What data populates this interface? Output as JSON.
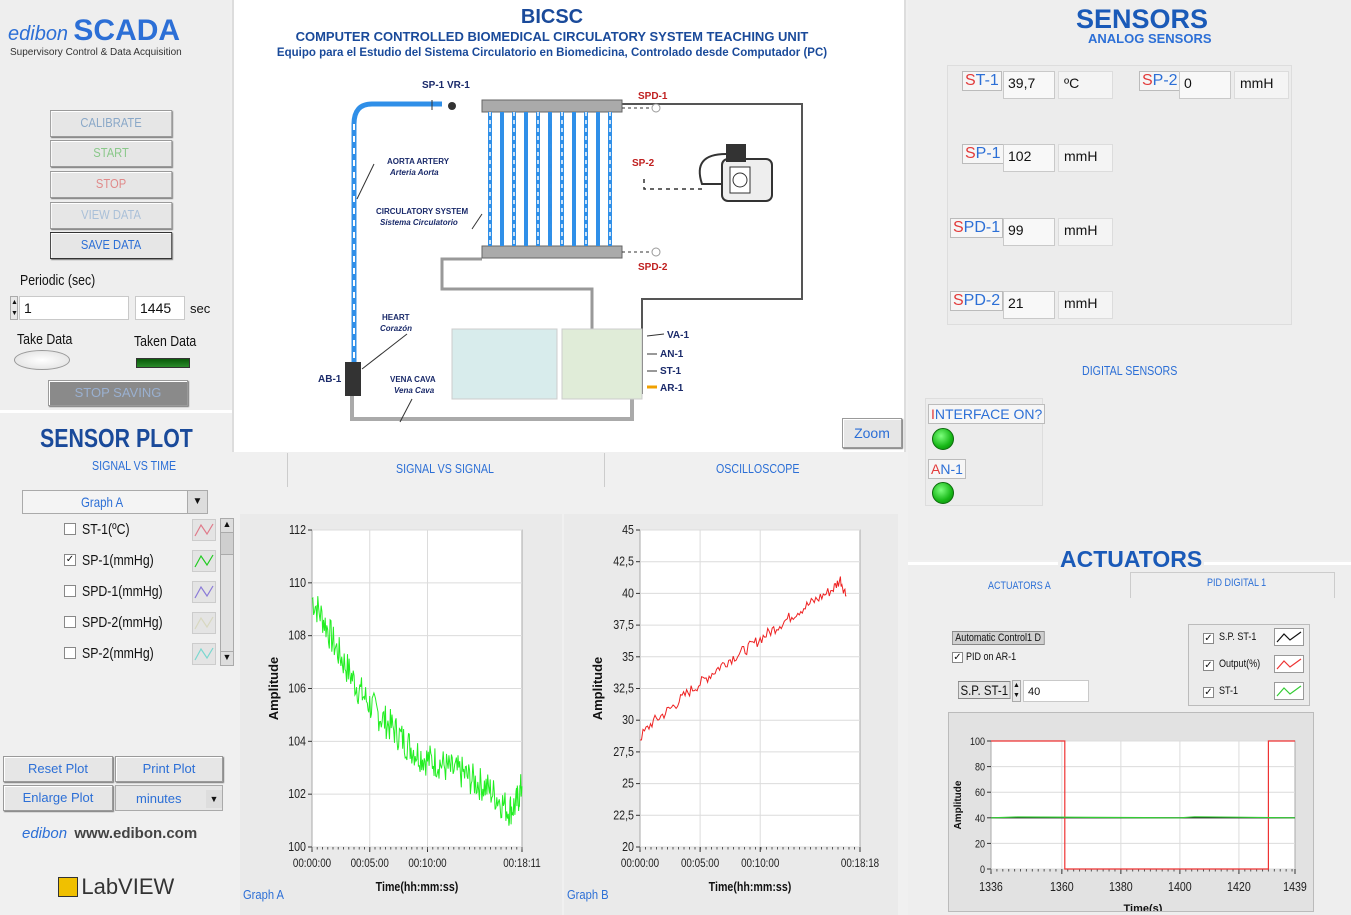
{
  "brand": {
    "logo_text": "edibon",
    "title": "SCADA",
    "subtitle": "Supervisory Control & Data Acquisition"
  },
  "controls": {
    "buttons": [
      "CALIBRATE",
      "START",
      "STOP",
      "VIEW DATA",
      "SAVE DATA"
    ],
    "periodic_label": "Periodic (sec)",
    "periodic_value": "1",
    "elapsed_value": "1445",
    "elapsed_unit": "sec",
    "take_data_label": "Take Data",
    "taken_data_label": "Taken Data",
    "stop_saving_label": "STOP SAVING"
  },
  "diagram": {
    "title": "BICSC",
    "subtitle": "COMPUTER CONTROLLED BIOMEDICAL CIRCULATORY SYSTEM TEACHING UNIT",
    "subtitle_es": "Equipo para el Estudio del Sistema Circulatorio en Biomedicina, Controlado desde Computador (PC)",
    "labels": {
      "sp1vr1": "SP-1 VR-1",
      "spd1": "SPD-1",
      "sp2": "SP-2",
      "spd2": "SPD-2",
      "aorta": "AORTA ARTERY",
      "aorta_es": "Arteria Aorta",
      "circ": "CIRCULATORY SYSTEM",
      "circ_es": "Sistema Circulatorio",
      "heart": "HEART",
      "heart_es": "Corazón",
      "vena": "VENA CAVA",
      "vena_es": "Vena Cava",
      "ab1": "AB-1",
      "va1": "VA-1",
      "an1": "AN-1",
      "st1": "ST-1",
      "ar1": "AR-1"
    },
    "zoom_label": "Zoom"
  },
  "sensors": {
    "title": "SENSORS",
    "analog_title": "ANALOG SENSORS",
    "digital_title": "DIGITAL SENSORS",
    "analog": [
      {
        "pre": "S",
        "post": "T-1",
        "value": "39,7",
        "unit": "ºC"
      },
      {
        "pre": "S",
        "post": "P-2",
        "value": "0",
        "unit": "mmH"
      },
      {
        "pre": "S",
        "post": "P-1",
        "value": "102",
        "unit": "mmH"
      },
      {
        "pre": "S",
        "post": "PD-1",
        "value": "99",
        "unit": "mmH"
      },
      {
        "pre": "S",
        "post": "PD-2",
        "value": "21",
        "unit": "mmH"
      }
    ],
    "digital": [
      {
        "label": "INTERFACE ON?",
        "pre": "I",
        "post": "NTERFACE ON?"
      },
      {
        "label": "AN-1",
        "pre": "A",
        "post": "N-1"
      }
    ]
  },
  "sensor_plot": {
    "title": "SENSOR PLOT",
    "tabs": [
      "SIGNAL VS TIME",
      "SIGNAL VS SIGNAL",
      "OSCILLOSCOPE"
    ],
    "graph_select": "Graph A",
    "channels": [
      {
        "label": "ST-1(ºC)",
        "checked": false,
        "color": "#e07a8a"
      },
      {
        "label": "SP-1(mmHg)",
        "checked": true,
        "color": "#22cc22"
      },
      {
        "label": "SPD-1(mmHg)",
        "checked": false,
        "color": "#8a7ad8"
      },
      {
        "label": "SPD-2(mmHg)",
        "checked": false,
        "color": "#d8d8c0"
      },
      {
        "label": "SP-2(mmHg)",
        "checked": false,
        "color": "#7ad8d0"
      }
    ],
    "reset_plot": "Reset Plot",
    "print_plot": "Print Plot",
    "enlarge_plot": "Enlarge Plot",
    "time_unit": "minutes"
  },
  "footer": {
    "url": "www.edibon.com",
    "labview": "LabVIEW"
  },
  "chart_data": [
    {
      "type": "line",
      "title": "Graph A",
      "xlabel": "Time(hh:mm:ss)",
      "ylabel": "Amplitude",
      "ylim": [
        100,
        112
      ],
      "yticks": [
        "112",
        "110",
        "108",
        "106",
        "104",
        "102",
        "100"
      ],
      "xticks": [
        "00:00:00",
        "00:05:00",
        "00:10:00",
        "00:18:11"
      ],
      "xlim_seconds": [
        0,
        1091
      ],
      "series": [
        {
          "color": "#22ee22",
          "x": [
            0,
            60,
            120,
            180,
            240,
            300,
            360,
            420,
            480,
            540,
            600,
            660,
            720,
            780,
            840,
            900,
            960,
            1020,
            1060,
            1091
          ],
          "y": [
            109.4,
            108.6,
            107.6,
            106.8,
            106.0,
            105.4,
            104.9,
            104.5,
            104.0,
            103.6,
            103.3,
            103.2,
            102.9,
            102.8,
            102.5,
            102.3,
            101.9,
            101.4,
            101.6,
            102.3
          ]
        }
      ]
    },
    {
      "type": "line",
      "title": "Graph B",
      "xlabel": "Time(hh:mm:ss)",
      "ylabel": "Amplitude",
      "ylim": [
        20,
        45
      ],
      "yticks": [
        "45",
        "42,5",
        "40",
        "37,5",
        "35",
        "32,5",
        "30",
        "27,5",
        "25",
        "22,5",
        "20"
      ],
      "xticks": [
        "00:00:00",
        "00:05:00",
        "00:10:00",
        "00:18:18"
      ],
      "xlim_seconds": [
        0,
        1098
      ],
      "series": [
        {
          "color": "#ee2222",
          "x": [
            0,
            60,
            120,
            180,
            240,
            300,
            360,
            420,
            480,
            540,
            600,
            660,
            720,
            780,
            840,
            900,
            960,
            1000,
            1030
          ],
          "y": [
            28.6,
            29.8,
            30.5,
            31.3,
            32.2,
            32.9,
            33.7,
            34.5,
            35.1,
            35.7,
            36.4,
            37.1,
            37.8,
            38.5,
            39.1,
            39.7,
            40.3,
            41.1,
            39.8
          ]
        }
      ]
    },
    {
      "type": "line",
      "title": "",
      "xlabel": "Time(s)",
      "ylabel": "Amplitude",
      "ylim": [
        0,
        100
      ],
      "yticks": [
        "100",
        "80",
        "60",
        "40",
        "20",
        "0"
      ],
      "xticks": [
        "1336",
        "1360",
        "1380",
        "1400",
        "1420",
        "1439"
      ],
      "xlim": [
        1336,
        1439
      ],
      "series": [
        {
          "name": "S.P. ST-1",
          "color": "#111111",
          "x": [
            1336,
            1439
          ],
          "y": [
            40,
            40
          ]
        },
        {
          "name": "Output(%)",
          "color": "#ee3333",
          "x": [
            1336,
            1361,
            1361,
            1430,
            1430,
            1439
          ],
          "y": [
            100,
            100,
            0,
            0,
            100,
            100
          ]
        },
        {
          "name": "ST-1",
          "color": "#33cc33",
          "x": [
            1336,
            1345,
            1400,
            1405,
            1439
          ],
          "y": [
            40,
            40.6,
            40,
            40.8,
            40
          ]
        }
      ]
    }
  ],
  "actuators": {
    "title": "ACTUATORS",
    "tabs": [
      "ACTUATORS A",
      "PID DIGITAL 1"
    ],
    "auto_label": "Automatic Control1 D",
    "pid_label": "PID on AR-1",
    "sp_label": "S.P. ST-1",
    "sp_value": "40",
    "legend": [
      "S.P. ST-1",
      "Output(%)",
      "ST-1"
    ]
  }
}
